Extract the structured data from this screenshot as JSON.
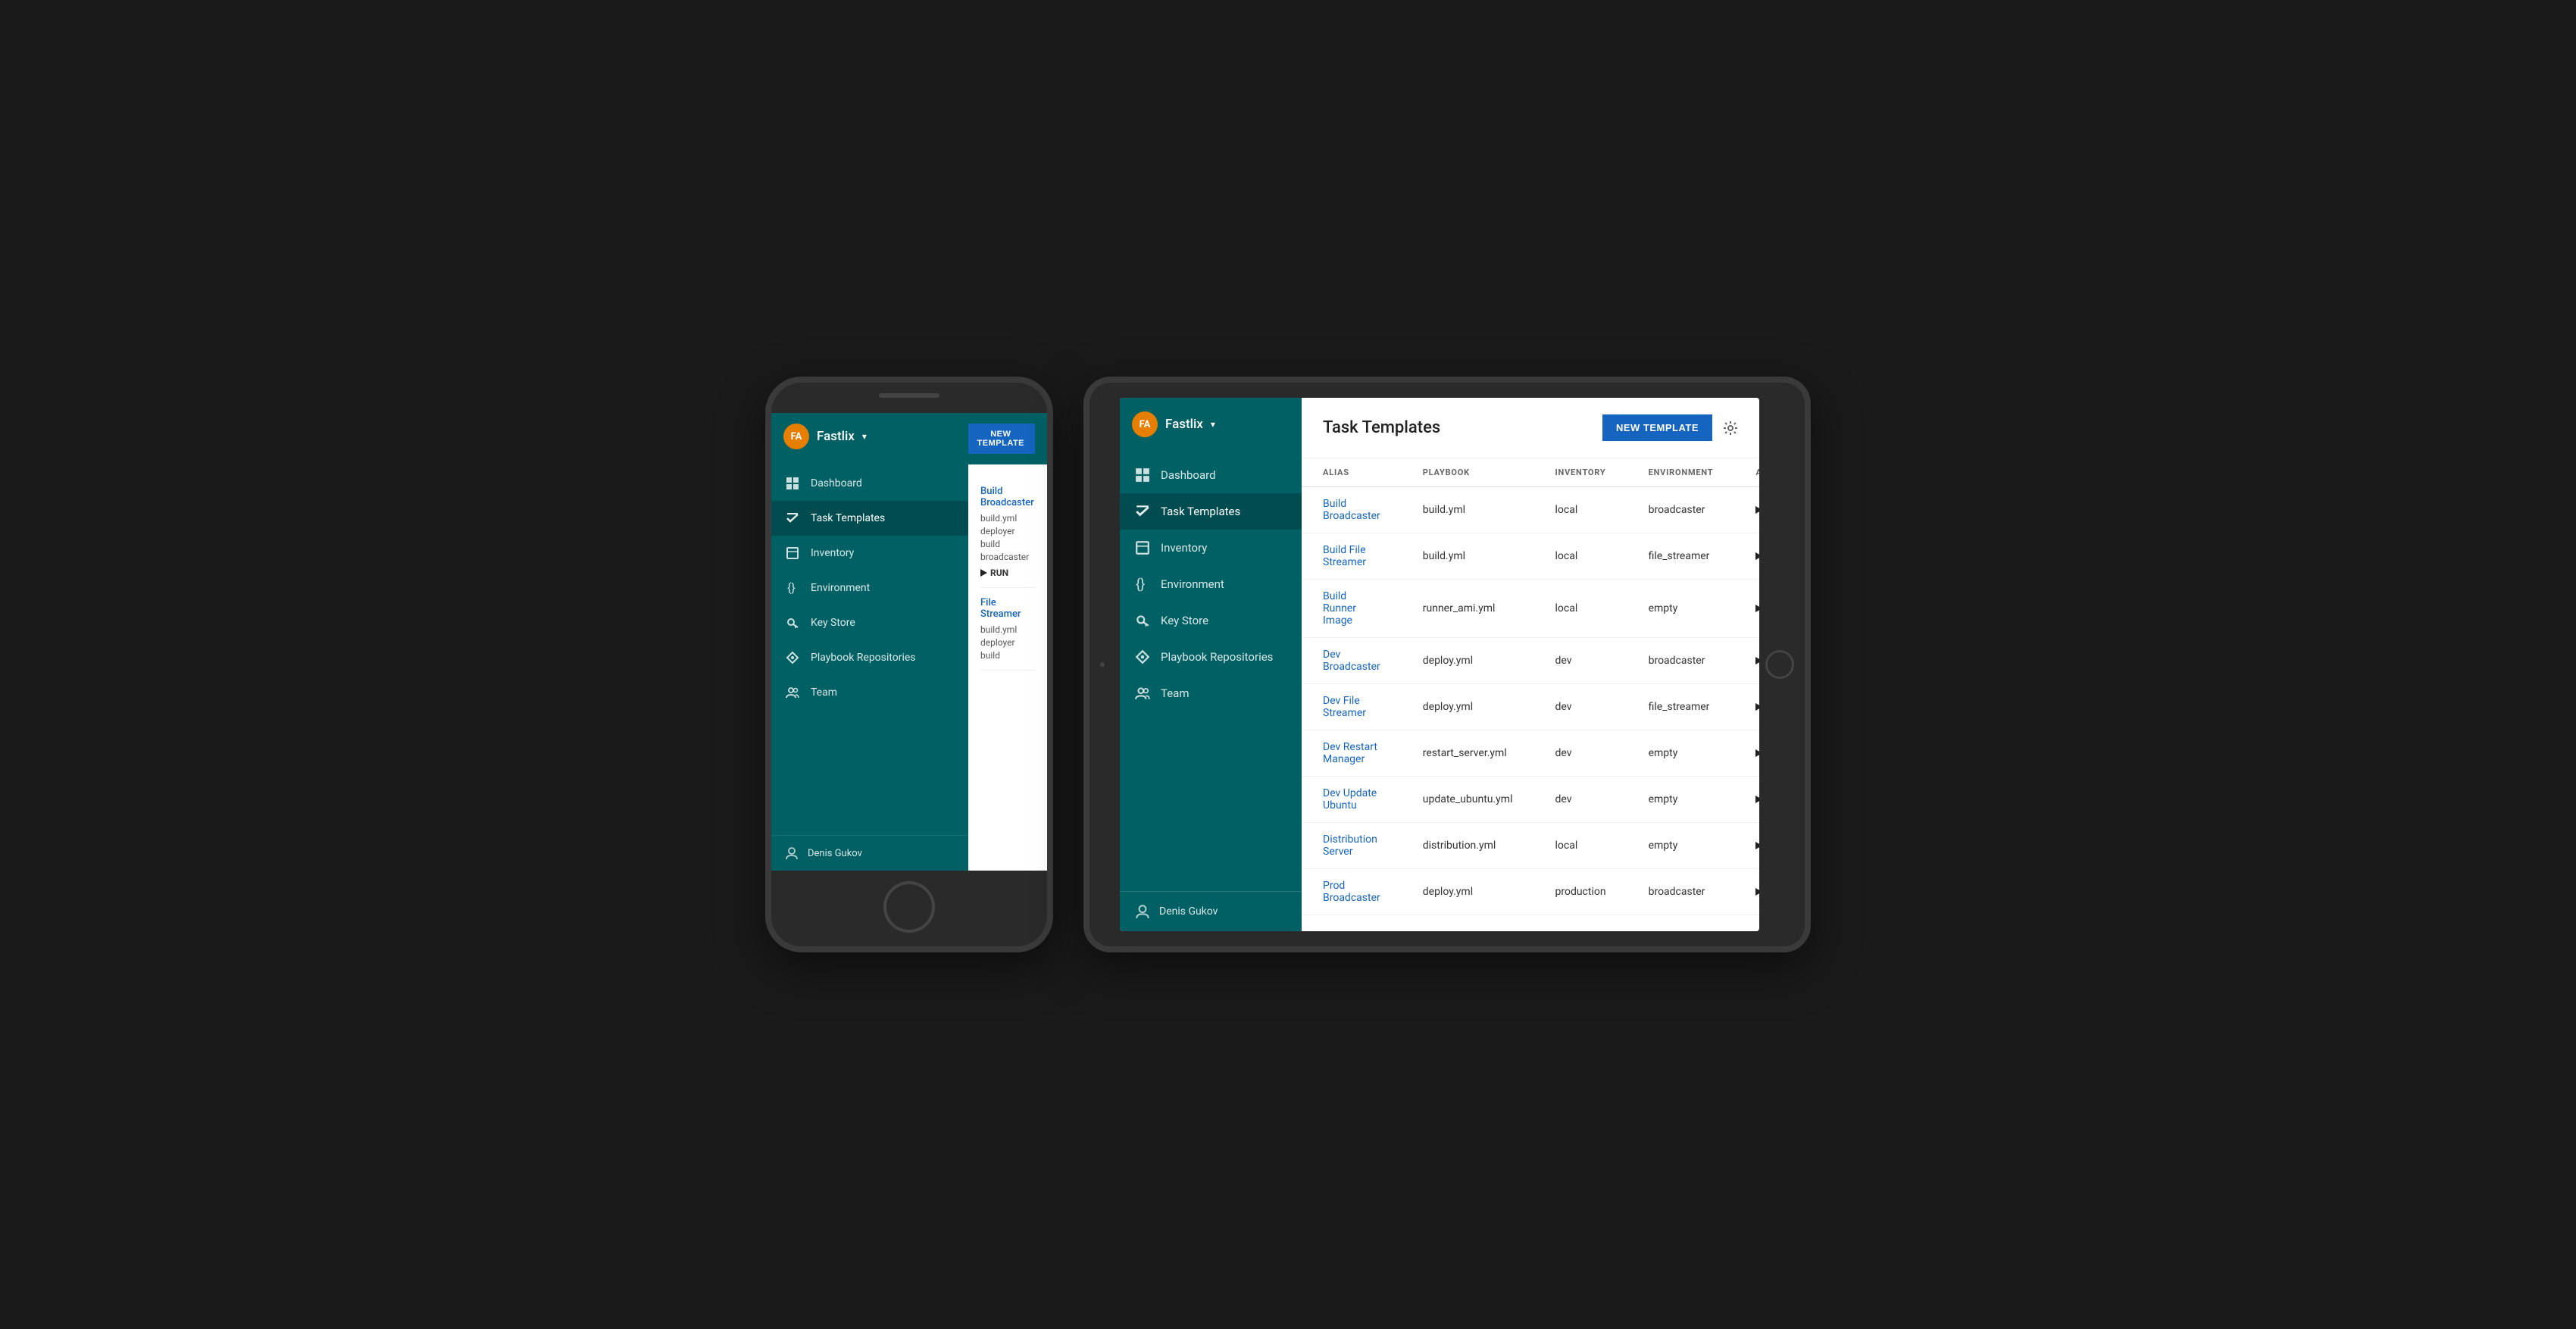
{
  "app": {
    "name": "Fastlix",
    "initials": "FA",
    "user": "Denis Gukov"
  },
  "sidebar": {
    "items": [
      {
        "id": "dashboard",
        "label": "Dashboard"
      },
      {
        "id": "task-templates",
        "label": "Task Templates",
        "active": true
      },
      {
        "id": "inventory",
        "label": "Inventory"
      },
      {
        "id": "environment",
        "label": "Environment"
      },
      {
        "id": "key-store",
        "label": "Key Store"
      },
      {
        "id": "playbook-repositories",
        "label": "Playbook Repositories"
      },
      {
        "id": "team",
        "label": "Team"
      }
    ]
  },
  "main": {
    "title": "Task Templates",
    "new_button": "NEW TEMPLATE",
    "table": {
      "headers": [
        "ALIAS",
        "PLAYBOOK",
        "INVENTORY",
        "ENVIRONMENT",
        "ACTIONS"
      ],
      "rows": [
        {
          "alias": "Build Broadcaster",
          "playbook": "build.yml",
          "inventory": "local",
          "environment": "broadcaster",
          "action": "RUN"
        },
        {
          "alias": "Build File Streamer",
          "playbook": "build.yml",
          "inventory": "local",
          "environment": "file_streamer",
          "action": "RUN"
        },
        {
          "alias": "Build Runner Image",
          "playbook": "runner_ami.yml",
          "inventory": "local",
          "environment": "empty",
          "action": "RUN"
        },
        {
          "alias": "Dev Broadcaster",
          "playbook": "deploy.yml",
          "inventory": "dev",
          "environment": "broadcaster",
          "action": "RUN"
        },
        {
          "alias": "Dev File Streamer",
          "playbook": "deploy.yml",
          "inventory": "dev",
          "environment": "file_streamer",
          "action": "RUN"
        },
        {
          "alias": "Dev Restart Manager",
          "playbook": "restart_server.yml",
          "inventory": "dev",
          "environment": "empty",
          "action": "RUN"
        },
        {
          "alias": "Dev Update Ubuntu",
          "playbook": "update_ubuntu.yml",
          "inventory": "dev",
          "environment": "empty",
          "action": "RUN"
        },
        {
          "alias": "Distribution Server",
          "playbook": "distribution.yml",
          "inventory": "local",
          "environment": "empty",
          "action": "RUN"
        },
        {
          "alias": "Prod Broadcaster",
          "playbook": "deploy.yml",
          "inventory": "production",
          "environment": "broadcaster",
          "action": "RUN"
        }
      ]
    }
  },
  "phone_content": {
    "rows": [
      {
        "title": "Build Broadcaster",
        "playbook": "build.yml",
        "deployer": "deployer",
        "build": "build",
        "environment": "broadcaster"
      },
      {
        "title": "File Streamer",
        "playbook": "build.yml",
        "deployer": "deployer",
        "build": "build"
      }
    ]
  }
}
